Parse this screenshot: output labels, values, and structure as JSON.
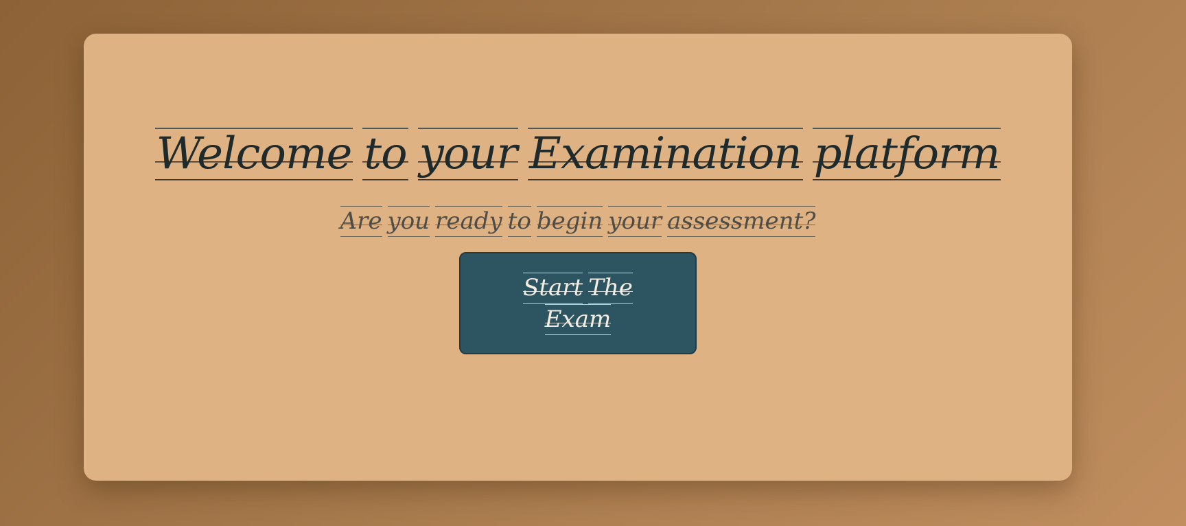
{
  "welcome": {
    "title_words": [
      "Welcome",
      "to",
      "your",
      "Examination",
      "platform"
    ],
    "subtitle_words": [
      "Are",
      "you",
      "ready",
      "to",
      "begin",
      "your",
      "assessment?"
    ]
  },
  "start_button": {
    "label_words": [
      "Start",
      "The",
      "Exam"
    ]
  },
  "colors": {
    "background": "#a0744a",
    "card": "#dfb283",
    "title_text": "#1e2a2c",
    "subtitle_text": "#4e4d48",
    "button": "#2d5461",
    "button_text": "#f3ece2"
  }
}
